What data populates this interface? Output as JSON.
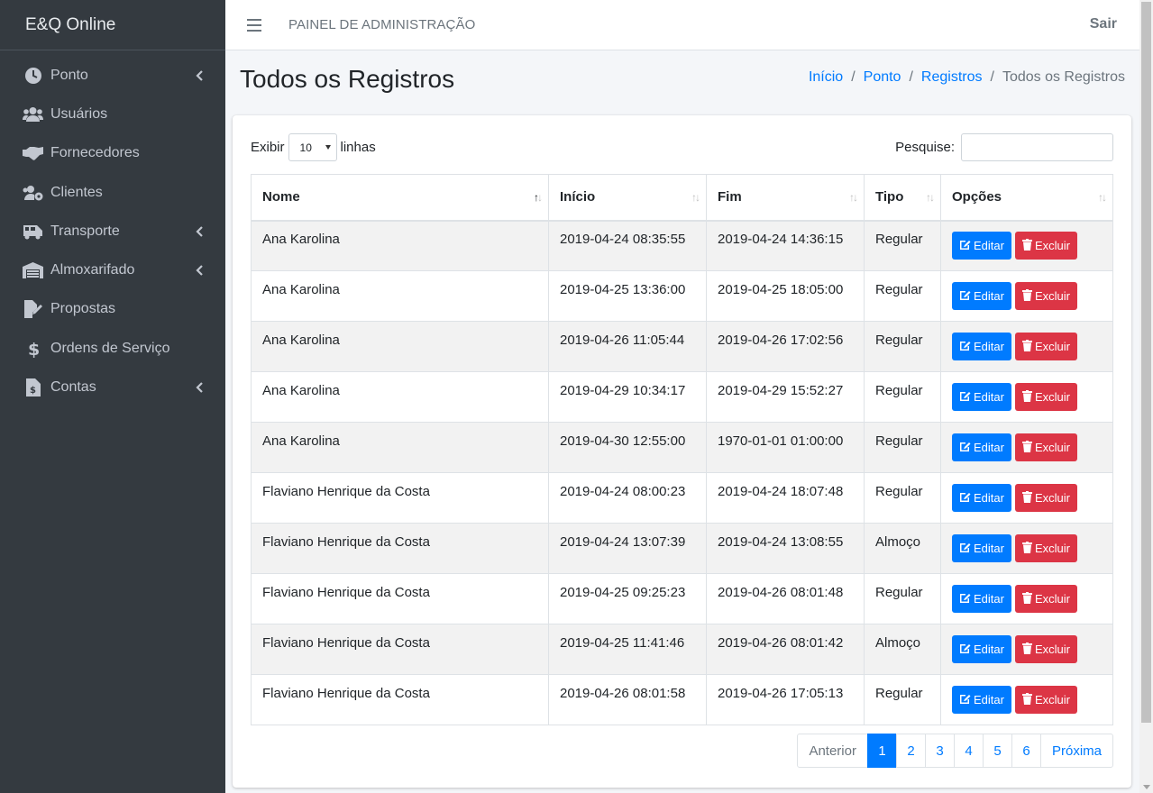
{
  "brand": "E&Q Online",
  "sidebar": {
    "items": [
      {
        "label": "Ponto",
        "icon": "clock-icon",
        "submenu": true
      },
      {
        "label": "Usuários",
        "icon": "users-icon",
        "submenu": false
      },
      {
        "label": "Fornecedores",
        "icon": "handshake-icon",
        "submenu": false
      },
      {
        "label": "Clientes",
        "icon": "users-cog-icon",
        "submenu": false
      },
      {
        "label": "Transporte",
        "icon": "shuttle-van-icon",
        "submenu": true
      },
      {
        "label": "Almoxarifado",
        "icon": "warehouse-icon",
        "submenu": true
      },
      {
        "label": "Propostas",
        "icon": "file-signature-icon",
        "submenu": false
      },
      {
        "label": "Ordens de Serviço",
        "icon": "dollar-sign-icon",
        "submenu": false
      },
      {
        "label": "Contas",
        "icon": "file-invoice-dollar-icon",
        "submenu": true
      }
    ]
  },
  "header": {
    "title": "PAINEL DE ADMINISTRAÇÃO",
    "logout": "Sair"
  },
  "page": {
    "title": "Todos os Registros"
  },
  "breadcrumb": {
    "home": "Início",
    "ponto": "Ponto",
    "registros": "Registros",
    "current": "Todos os Registros",
    "separator": "/"
  },
  "table_controls": {
    "show_label": "Exibir",
    "show_value": "10",
    "rows_label": "linhas",
    "search_label": "Pesquise:",
    "search_value": ""
  },
  "table": {
    "columns": [
      "Nome",
      "Início",
      "Fim",
      "Tipo",
      "Opções"
    ],
    "edit_label": "Editar",
    "delete_label": "Excluir",
    "rows": [
      {
        "nome": "Ana Karolina",
        "inicio": "2019-04-24 08:35:55",
        "fim": "2019-04-24 14:36:15",
        "tipo": "Regular"
      },
      {
        "nome": "Ana Karolina",
        "inicio": "2019-04-25 13:36:00",
        "fim": "2019-04-25 18:05:00",
        "tipo": "Regular"
      },
      {
        "nome": "Ana Karolina",
        "inicio": "2019-04-26 11:05:44",
        "fim": "2019-04-26 17:02:56",
        "tipo": "Regular"
      },
      {
        "nome": "Ana Karolina",
        "inicio": "2019-04-29 10:34:17",
        "fim": "2019-04-29 15:52:27",
        "tipo": "Regular"
      },
      {
        "nome": "Ana Karolina",
        "inicio": "2019-04-30 12:55:00",
        "fim": "1970-01-01 01:00:00",
        "tipo": "Regular"
      },
      {
        "nome": "Flaviano Henrique da Costa",
        "inicio": "2019-04-24 08:00:23",
        "fim": "2019-04-24 18:07:48",
        "tipo": "Regular"
      },
      {
        "nome": "Flaviano Henrique da Costa",
        "inicio": "2019-04-24 13:07:39",
        "fim": "2019-04-24 13:08:55",
        "tipo": "Almoço"
      },
      {
        "nome": "Flaviano Henrique da Costa",
        "inicio": "2019-04-25 09:25:23",
        "fim": "2019-04-26 08:01:48",
        "tipo": "Regular"
      },
      {
        "nome": "Flaviano Henrique da Costa",
        "inicio": "2019-04-25 11:41:46",
        "fim": "2019-04-26 08:01:42",
        "tipo": "Almoço"
      },
      {
        "nome": "Flaviano Henrique da Costa",
        "inicio": "2019-04-26 08:01:58",
        "fim": "2019-04-26 17:05:13",
        "tipo": "Regular"
      }
    ]
  },
  "pagination": {
    "previous": "Anterior",
    "next": "Próxima",
    "pages": [
      "1",
      "2",
      "3",
      "4",
      "5",
      "6"
    ],
    "active": "1"
  },
  "colors": {
    "sidebar_bg": "#343a40",
    "primary": "#007bff",
    "danger": "#dc3545"
  }
}
